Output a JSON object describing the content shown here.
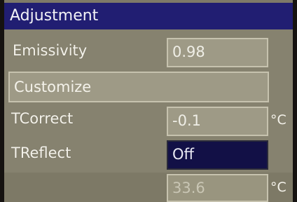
{
  "window": {
    "title": "Adjustment"
  },
  "rows": {
    "emissivity": {
      "label": "Emissivity",
      "value": "0.98"
    },
    "customize": {
      "label": "Customize"
    },
    "tcorrect": {
      "label": "TCorrect",
      "value": "-0.1",
      "unit": "°C"
    },
    "treflect": {
      "label": "TReflect",
      "value": "Off"
    },
    "temperature": {
      "value": "33.6",
      "unit": "°C"
    }
  },
  "colors": {
    "title_bar": "#211e72",
    "selected_field": "#121046",
    "panel": "#86826f"
  }
}
